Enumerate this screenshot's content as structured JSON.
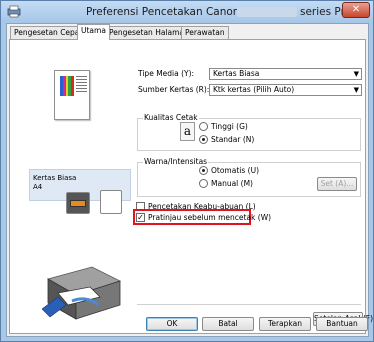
{
  "window": {
    "title_prefix": "Preferensi Pencetakan Canon",
    "title_suffix": "series Printer",
    "close_label": "✕"
  },
  "tabs": [
    {
      "label": "Pengesetan Cepat"
    },
    {
      "label": "Utama"
    },
    {
      "label": "Pengesetan Halaman"
    },
    {
      "label": "Perawatan"
    }
  ],
  "left": {
    "media_name": "Kertas Biasa",
    "media_size": "A4"
  },
  "form": {
    "media_type_label": "Tipe Media (Y):",
    "media_type_value": "Kertas Biasa",
    "paper_source_label": "Sumber Kertas (R):",
    "paper_source_value": "Ktk kertas (Pilih Auto)",
    "quality_group": "Kualitas Cetak",
    "quality_high": "Tinggi (G)",
    "quality_standard": "Standar (N)",
    "color_group": "Warna/Intensitas",
    "color_auto": "Otomatis (U)",
    "color_manual": "Manual (M)",
    "set_button": "Set (A)...",
    "grayscale_label": "Pencetakan Keabu-abuan (L)",
    "preview_label": "Pratinjau sebelum mencetak (W)",
    "defaults_button": "Setelan Asal (F)"
  },
  "state": {
    "quality": "standard",
    "color": "auto",
    "grayscale": false,
    "preview": true
  },
  "footer": {
    "ok": "OK",
    "cancel": "Batal",
    "apply": "Terapkan",
    "help": "Bantuan"
  },
  "colors": {
    "title_bar": "#a8c8e8",
    "close_button": "#c8462e",
    "highlight_box": "#e0141e",
    "media_box": "#dfe8f5"
  }
}
